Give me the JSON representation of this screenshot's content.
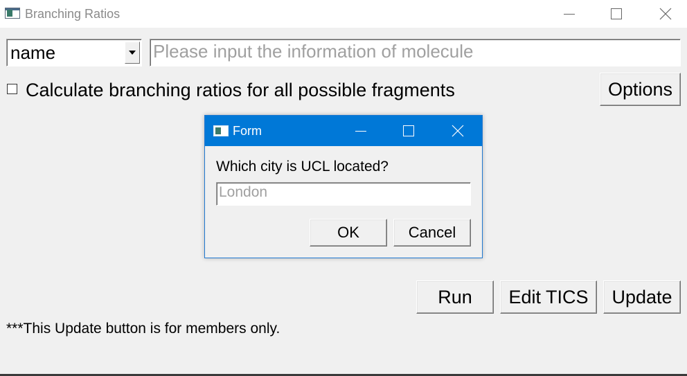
{
  "window": {
    "title": "Branching Ratios",
    "controls": {
      "minimize_icon": "minimize-icon",
      "maximize_icon": "maximize-icon",
      "close_icon": "close-icon"
    }
  },
  "search": {
    "type_selected": "name",
    "placeholder": "Please input the information of molecule"
  },
  "options": {
    "checkbox_label": "Calculate branching ratios for all possible fragments",
    "checkbox_checked": false,
    "options_button": "Options"
  },
  "actions": {
    "run_button": "Run",
    "edit_tics_button": "Edit TICS",
    "update_button": "Update"
  },
  "footer_note": "***This Update button is for members only.",
  "dialog": {
    "title": "Form",
    "question": "Which city is UCL located?",
    "answer_placeholder": "London",
    "ok_button": "OK",
    "cancel_button": "Cancel"
  },
  "colors": {
    "dialog_titlebar": "#0078d7",
    "window_bg": "#f0f0f0",
    "placeholder_text": "#a0a0a0"
  }
}
